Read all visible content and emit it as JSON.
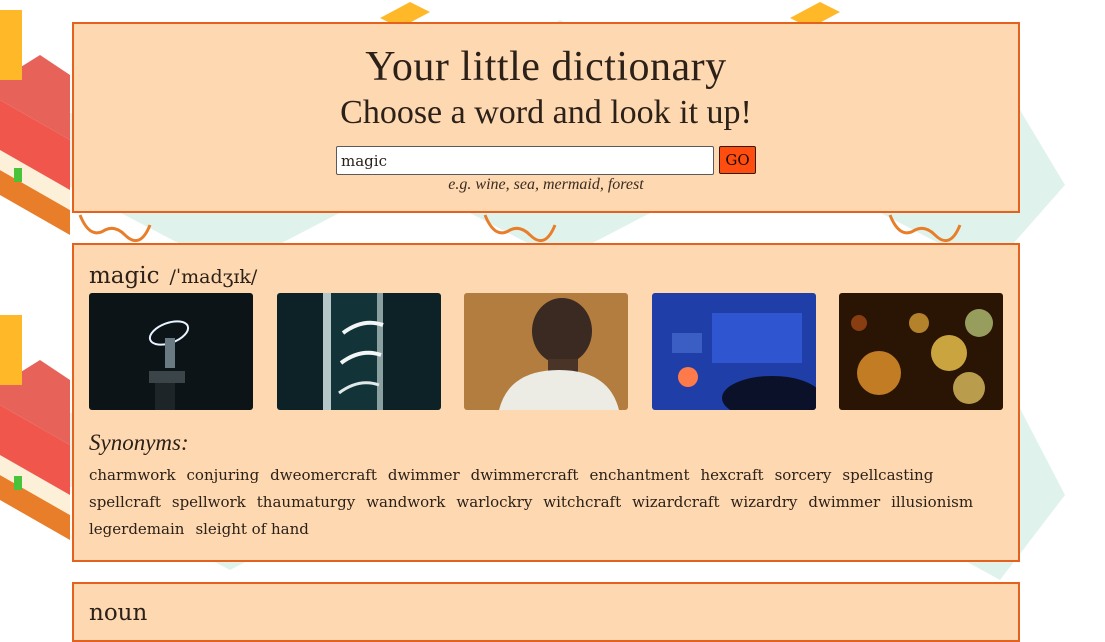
{
  "header": {
    "title": "Your little dictionary",
    "subtitle": "Choose a word and look it up!",
    "search": {
      "value": "magic",
      "button_label": "GO"
    },
    "hint": "e.g. wine, sea, mermaid, forest"
  },
  "entry": {
    "word": "magic",
    "phonetic": "/ˈmadʒɪk/",
    "images": [
      {
        "name": "light-painting-figure-image"
      },
      {
        "name": "light-streaks-doorway-image"
      },
      {
        "name": "man-back-view-image"
      },
      {
        "name": "blue-desk-glowing-ball-image"
      },
      {
        "name": "golden-bokeh-image"
      }
    ],
    "synonyms_title": "Synonyms:",
    "synonyms": [
      "charmwork",
      "conjuring",
      "dweomercraft",
      "dwimmer",
      "dwimmercraft",
      "enchantment",
      "hexcraft",
      "sorcery",
      "spellcasting",
      "spellcraft",
      "spellwork",
      "thaumaturgy",
      "wandwork",
      "warlockry",
      "witchcraft",
      "wizardcraft",
      "wizardry",
      "dwimmer",
      "illusionism",
      "legerdemain",
      "sleight of hand"
    ]
  },
  "next_section": {
    "label": "noun"
  },
  "colors": {
    "card_bg": "#fed8b1",
    "card_border": "#e2621e",
    "go_button": "#ff4c0f"
  }
}
